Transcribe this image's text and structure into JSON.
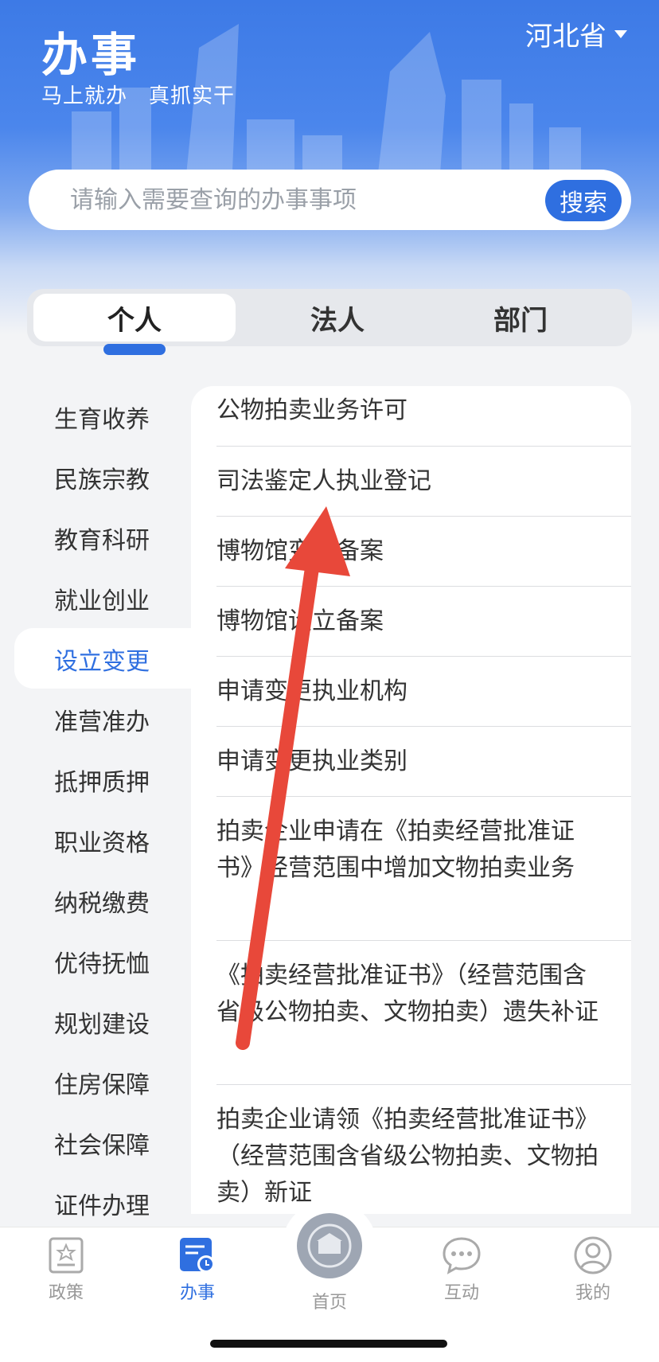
{
  "header": {
    "title": "办事",
    "slogan": "马上就办　真抓实干",
    "region": "河北省"
  },
  "search": {
    "placeholder": "请输入需要查询的办事事项",
    "button_label": "搜索"
  },
  "tabs": [
    {
      "label": "个人",
      "active": true
    },
    {
      "label": "法人",
      "active": false
    },
    {
      "label": "部门",
      "active": false
    }
  ],
  "sidebar": {
    "items": [
      {
        "label": "生育收养"
      },
      {
        "label": "民族宗教"
      },
      {
        "label": "教育科研"
      },
      {
        "label": "就业创业"
      },
      {
        "label": "设立变更",
        "active": true
      },
      {
        "label": "准营准办"
      },
      {
        "label": "抵押质押"
      },
      {
        "label": "职业资格"
      },
      {
        "label": "纳税缴费"
      },
      {
        "label": "优待抚恤"
      },
      {
        "label": "规划建设"
      },
      {
        "label": "住房保障"
      },
      {
        "label": "社会保障"
      },
      {
        "label": "证件办理"
      }
    ]
  },
  "services": [
    {
      "label": "公物拍卖业务许可"
    },
    {
      "label": "司法鉴定人执业登记"
    },
    {
      "label": "博物馆变更备案"
    },
    {
      "label": "博物馆设立备案"
    },
    {
      "label": "申请变更执业机构"
    },
    {
      "label": "申请变更执业类别"
    },
    {
      "label": "拍卖企业申请在《拍卖经营批准证书》经营范围中增加文物拍卖业务"
    },
    {
      "label": "《拍卖经营批准证书》（经营范围含省级公物拍卖、文物拍卖）遗失补证"
    },
    {
      "label": "拍卖企业请领《拍卖经营批准证书》（经营范围含省级公物拍卖、文物拍卖）新证"
    }
  ],
  "tabbar": {
    "items": [
      {
        "label": "政策",
        "icon": "policy-icon"
      },
      {
        "label": "办事",
        "icon": "affairs-icon",
        "active": true
      },
      {
        "label": "首页",
        "icon": "emblem-icon"
      },
      {
        "label": "互动",
        "icon": "chat-icon"
      },
      {
        "label": "我的",
        "icon": "user-icon"
      }
    ]
  },
  "colors": {
    "accent": "#2f6fe0",
    "header_top": "#3d7ae6",
    "annotation_arrow": "#e8483a"
  }
}
